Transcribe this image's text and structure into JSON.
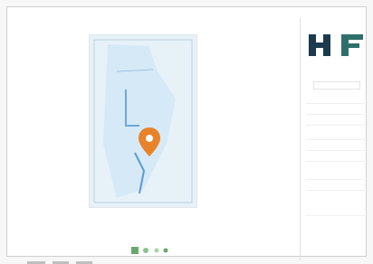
{
  "page": {
    "title_block": {
      "logo_text": "H F",
      "company_line": "",
      "sheet_title": "",
      "rows": [
        "",
        "",
        "",
        "",
        "",
        "",
        "",
        "",
        ""
      ],
      "signature_text": "",
      "footer_lines": [
        "",
        ""
      ]
    },
    "map": {
      "marker_icon": "map-pin-icon",
      "background_color": "#e7f1f8",
      "marker_color": "#e8832a"
    },
    "bottom_bar": {
      "green_logo_icon": "seal-logo-icon",
      "legend_bars": [
        "",
        "",
        ""
      ]
    },
    "colors": {
      "logo_dark": "#1b3a4d",
      "logo_green": "#2e6f6a",
      "water_light": "#cde3f3",
      "green": "#6aa86d"
    }
  }
}
